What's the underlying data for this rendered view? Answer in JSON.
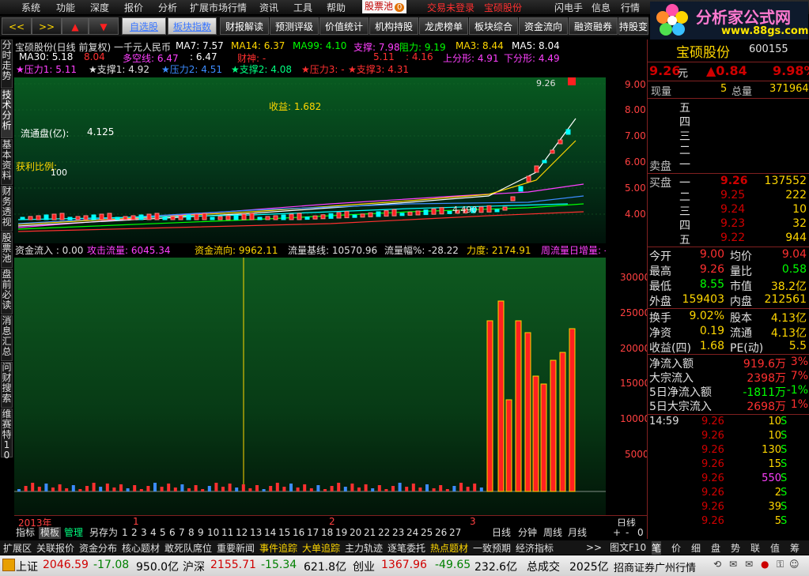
{
  "menu": {
    "items": [
      "系统",
      "功能",
      "深度",
      "报价",
      "分析",
      "扩展市场行情",
      "资讯",
      "工具",
      "帮助"
    ],
    "pool": "股票池",
    "pool_badge": "0",
    "login_status": "交易未登录",
    "stock_menu": "宝硕股份",
    "right": [
      "闪电手",
      "信息",
      "行情"
    ]
  },
  "toolbar": {
    "buttons": [
      "自选股",
      "板块指数",
      "财报解读",
      "预测评级",
      "价值统计",
      "机构持股",
      "龙虎榜单",
      "板块综合",
      "资金流向",
      "融资融券",
      "持股变"
    ]
  },
  "logo": {
    "text": "分析家公式网",
    "url": "www.88gs.com"
  },
  "left_tabs": [
    "分时走势",
    "技术分析",
    "基本资料",
    "财务透视",
    "股票池",
    "盘前必读",
    "消息汇总",
    "问财搜索",
    "维赛特10"
  ],
  "chart1": {
    "title": "宝硕股份(日线 前复权) 一千元人民币",
    "ma7": "MA7: 7.57",
    "ma14": "MA14: 6.37",
    "ma99": "MA99: 4.10",
    "support": "支撑: 7.98",
    "resist": "阻力: 9.19",
    "ma3": "MA3: 8.44",
    "ma5": "MA5: 8.04",
    "ma30": "MA30: 5.18",
    "v804": "8.04",
    "dkx": "多空线: 6.47",
    "v647": ": 6.47",
    "caishen": "财神: -",
    "v511": "5.11",
    "v416": ": 4.16",
    "upper": "上分形: 4.91",
    "lower": "下分形: 4.49",
    "p1": "★压力1: 5.11",
    "s1": "★支撑1: 4.92",
    "p2": "★压力2: 4.51",
    "s2": "★支撑2: 4.08",
    "p3": "★压力3: -",
    "s3": "★支撑3: 4.31",
    "profit": "收益: 1.682",
    "float": "流通盘(亿):",
    "float_val": "4.125",
    "ratio": "获利比例:",
    "ratio_val": "100",
    "high_label": "9.26",
    "low_label": "4.490",
    "yticks": [
      "9.00",
      "8.00",
      "7.00",
      "6.00",
      "5.00",
      "4.00"
    ]
  },
  "chart2": {
    "h1": "资金流入  : 0.00",
    "h2": "攻击流量: 6045.34",
    "h3": "资金流向: 9962.11",
    "h4": "流量基线: 10570.96",
    "h5": "流量幅%: -28.22",
    "h6": "力度: 2174.91",
    "h7": "周流量日增量: -",
    "yticks": [
      "30000",
      "25000",
      "20000",
      "15000",
      "10000",
      "5000"
    ]
  },
  "xaxis": {
    "year": "2013年",
    "m1": "1",
    "m2": "2",
    "m3": "3",
    "period": "日线"
  },
  "quote": {
    "name": "宝硕股份",
    "code": "600155",
    "price": "9.26",
    "unit": "元",
    "change": "▲0.84",
    "pct": "9.98%",
    "now_label": "现量",
    "now_vol": "5",
    "total_label": "总量",
    "total_vol": "371964",
    "sell_label": "卖盘",
    "sell_levels": [
      "五",
      "四",
      "三",
      "二",
      "一"
    ],
    "buy_label": "买盘",
    "bids": [
      {
        "lvl": "一",
        "price": "9.26",
        "vol": "137552"
      },
      {
        "lvl": "二",
        "price": "9.25",
        "vol": "222"
      },
      {
        "lvl": "三",
        "price": "9.24",
        "vol": "10"
      },
      {
        "lvl": "四",
        "price": "9.23",
        "vol": "32"
      },
      {
        "lvl": "五",
        "price": "9.22",
        "vol": "944"
      }
    ],
    "stats": [
      [
        "今开",
        "9.00",
        "均价",
        "9.04"
      ],
      [
        "最高",
        "9.26",
        "量比",
        "0.58"
      ],
      [
        "最低",
        "8.55",
        "市值",
        "38.2亿"
      ],
      [
        "外盘",
        "159403",
        "内盘",
        "212561"
      ]
    ],
    "stats2": [
      [
        "换手",
        "9.02%",
        "股本",
        "4.13亿"
      ],
      [
        "净资",
        "0.19",
        "流通",
        "4.13亿"
      ],
      [
        "收益(四)",
        "1.68",
        "PE(动)",
        "5.5"
      ]
    ],
    "flows": [
      [
        "净流入额",
        "919.6万",
        "3%"
      ],
      [
        "大宗流入",
        "2398万",
        "7%"
      ],
      [
        "5日净流入额",
        "-1811万",
        "-1%"
      ],
      [
        "5日大宗流入",
        "2698万",
        "1%"
      ]
    ],
    "ticks": [
      {
        "t": "14:59",
        "p": "9.26",
        "v": "10",
        "s": "S"
      },
      {
        "t": "",
        "p": "9.26",
        "v": "10",
        "s": "S"
      },
      {
        "t": "",
        "p": "9.26",
        "v": "130",
        "s": "S"
      },
      {
        "t": "",
        "p": "9.26",
        "v": "15",
        "s": "S"
      },
      {
        "t": "",
        "p": "9.26",
        "v": "550",
        "s": "S"
      },
      {
        "t": "",
        "p": "9.26",
        "v": "2",
        "s": "S"
      },
      {
        "t": "",
        "p": "9.26",
        "v": "39",
        "s": "S"
      },
      {
        "t": "",
        "p": "9.26",
        "v": "5",
        "s": "S"
      }
    ]
  },
  "bottom_tabs": {
    "left": [
      "指标",
      "模板",
      "管理",
      "另存为"
    ],
    "nums": [
      "1",
      "2",
      "3",
      "4",
      "5",
      "6",
      "7",
      "8",
      "9",
      "10",
      "11",
      "12",
      "13",
      "14",
      "15",
      "16",
      "17",
      "18",
      "19",
      "20",
      "21",
      "22",
      "23",
      "24",
      "25",
      "26",
      "27"
    ],
    "right": [
      "日线",
      "分钟",
      "周线",
      "月线"
    ],
    "pm": [
      "+",
      "-",
      "0"
    ]
  },
  "bar2": {
    "items": [
      "扩展区",
      "关联报价",
      "资金分布",
      "核心题材",
      "敢死队席位",
      "重要新闻",
      "事件追踪",
      "大单追踪",
      "主力轨迹",
      "逐笔委托",
      "热点题材",
      "一致预期",
      "经济指标"
    ],
    "more": ">>",
    "graph": "图文F10",
    "rtabs": [
      "笔",
      "价",
      "细",
      "盘",
      "势",
      "联",
      "值",
      "筹"
    ]
  },
  "status": {
    "sh_label": "上证",
    "sh": "2046.59",
    "sh_chg": "-17.08",
    "sh_amt": "950.0亿",
    "sz_label": "沪深",
    "sz": "2155.71",
    "sz_chg": "-15.34",
    "sz_amt": "621.8亿",
    "cy_label": "创业",
    "cy": "1367.96",
    "cy_chg": "-49.65",
    "cy_amt": "232.6亿",
    "tot_label": "总成交",
    "tot": "2025亿",
    "broker": "招商证券广州行情"
  }
}
